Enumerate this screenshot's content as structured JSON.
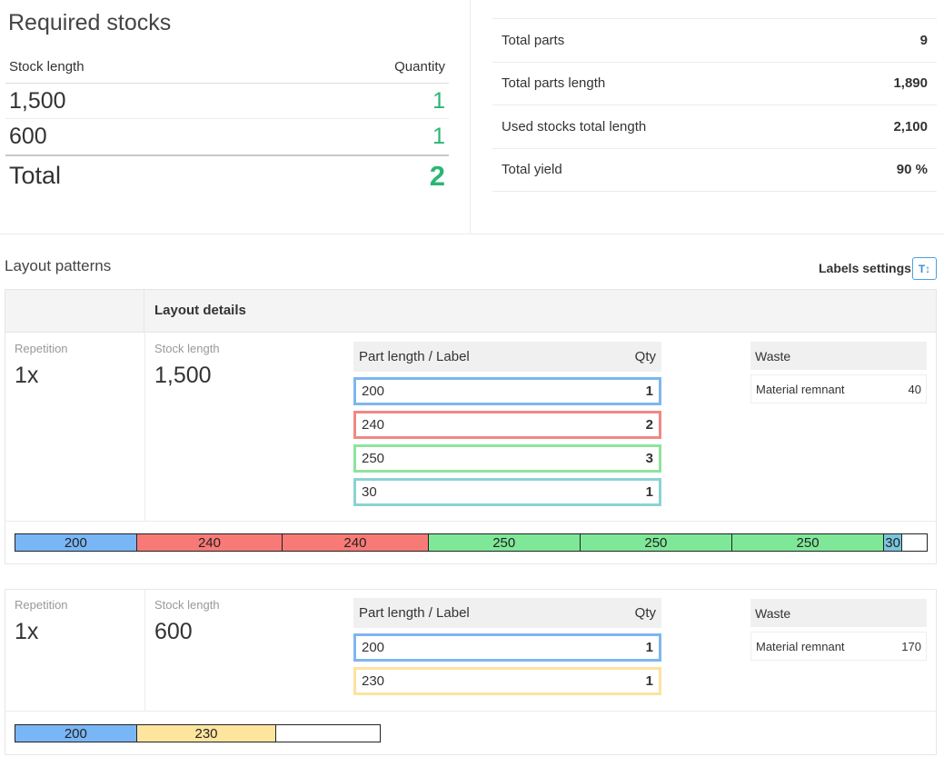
{
  "required_stocks": {
    "title": "Required stocks",
    "col_stock_length": "Stock length",
    "col_quantity": "Quantity",
    "rows": [
      {
        "length": "1,500",
        "qty": "1"
      },
      {
        "length": "600",
        "qty": "1"
      }
    ],
    "total_label": "Total",
    "total_qty": "2"
  },
  "summary": [
    {
      "label": "Total parts",
      "value": "9"
    },
    {
      "label": "Total parts length",
      "value": "1,890"
    },
    {
      "label": "Used stocks total length",
      "value": "2,100"
    },
    {
      "label": "Total yield",
      "value": "90 %"
    }
  ],
  "layout_patterns": {
    "title": "Layout patterns",
    "labels_settings": "Labels settings",
    "labels_settings_icon": "T↕",
    "details_header": "Layout details",
    "repetition_label": "Repetition",
    "stock_length_label": "Stock length",
    "parts_header_label": "Part length / Label",
    "parts_header_qty": "Qty",
    "waste_header": "Waste",
    "patterns": [
      {
        "repetition": "1x",
        "stock_length": "1,500",
        "stock_value": 1500,
        "parts": [
          {
            "label": "200",
            "qty": "1",
            "color": "#7fb6ef"
          },
          {
            "label": "240",
            "qty": "2",
            "color": "#f18883"
          },
          {
            "label": "250",
            "qty": "3",
            "color": "#8ee49c"
          },
          {
            "label": "30",
            "qty": "1",
            "color": "#8ad3d3"
          }
        ],
        "waste": {
          "label": "Material remnant",
          "value": "40"
        },
        "bar": [
          {
            "label": "200",
            "length": 200,
            "color": "#79b6f6"
          },
          {
            "label": "240",
            "length": 240,
            "color": "#f87a76"
          },
          {
            "label": "240",
            "length": 240,
            "color": "#f87a76"
          },
          {
            "label": "250",
            "length": 250,
            "color": "#7fe898"
          },
          {
            "label": "250",
            "length": 250,
            "color": "#7fe898"
          },
          {
            "label": "250",
            "length": 250,
            "color": "#7fe898"
          },
          {
            "label": "30",
            "length": 30,
            "color": "#79c6dd"
          },
          {
            "label": "",
            "length": 40,
            "color": "#ffffff"
          }
        ]
      },
      {
        "repetition": "1x",
        "stock_length": "600",
        "stock_value": 600,
        "parts": [
          {
            "label": "200",
            "qty": "1",
            "color": "#7fb6ef"
          },
          {
            "label": "230",
            "qty": "1",
            "color": "#fbe3a0"
          }
        ],
        "waste": {
          "label": "Material remnant",
          "value": "170"
        },
        "bar": [
          {
            "label": "200",
            "length": 200,
            "color": "#79b6f6"
          },
          {
            "label": "230",
            "length": 230,
            "color": "#fde59e"
          },
          {
            "label": "",
            "length": 170,
            "color": "#ffffff"
          }
        ]
      }
    ]
  }
}
